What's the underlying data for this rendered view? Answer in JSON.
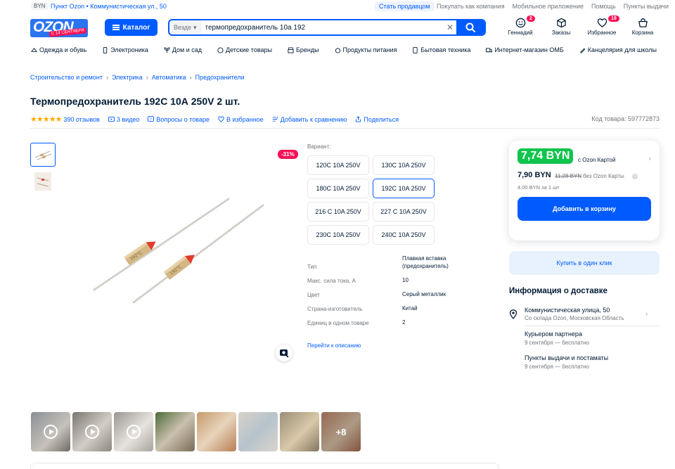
{
  "topbar": {
    "currency": "BYN",
    "pickup_point": "Пункт Ozon • Коммунистическая ул., 50",
    "sell_link": "Стать продавцом",
    "links": [
      "Покупать как компания",
      "Мобильное приложение",
      "Помощь",
      "Пункты выдачи"
    ]
  },
  "header": {
    "logo_text": "OZON",
    "logo_badge": "С 14 СЕНТЯБРЯ",
    "catalog_label": "Каталог",
    "search_scope": "Везде",
    "search_query": "термопредохранитель 10а 192",
    "user_label": "Геннадий",
    "user_badge": "2",
    "orders_label": "Заказы",
    "favorites_label": "Избранное",
    "favorites_badge": "19",
    "cart_label": "Корзина"
  },
  "categories": [
    "Одежда и обувь",
    "Электроника",
    "Дом и сад",
    "Детские товары",
    "Бренды",
    "Продукты питания",
    "Бытовая техника",
    "Интернет-магазин ОМБ",
    "Канцелярия для школы"
  ],
  "breadcrumb": [
    "Строительство и ремонт",
    "Электрика",
    "Автоматика",
    "Предохранители"
  ],
  "product": {
    "title": "Термопредохранитель 192С 10А 250V 2 шт.",
    "stars": "★★★★★",
    "reviews": "390 отзывов",
    "videos": "3 видео",
    "questions": "Вопросы о товаре",
    "favorite": "В избранное",
    "compare": "Добавить к сравнению",
    "share": "Поделиться",
    "code": "Код товара: 597772873",
    "discount": "-31%"
  },
  "variants": {
    "label": "Вариант:",
    "items": [
      "120C 10A 250V",
      "130C 10A 250V",
      "180C 10A 250V",
      "192C 10A 250V",
      "216 C 10A 250V",
      "227 C 10A 250V",
      "230C 10A 250V",
      "240C 10A 250V"
    ],
    "selected": "192C 10A 250V"
  },
  "specs": [
    {
      "key": "Тип",
      "value": "Плавкая вставка (предохранитель)"
    },
    {
      "key": "Макс. сила тока, А",
      "value": "10"
    },
    {
      "key": "Цвет",
      "value": "Серый металлик"
    },
    {
      "key": "Страна-изготовитель",
      "value": "Китай"
    },
    {
      "key": "Единиц в одном товаре",
      "value": "2"
    }
  ],
  "description_link": "Перейти к описанию",
  "price": {
    "card_price": "7,74 BYN",
    "card_label": "с Ozon Картой",
    "regular_price": "7,90 BYN",
    "old_price": "11,28 BYN",
    "without_card": "без Ozon Карты",
    "per_unit": "4,00 BYN за 1 шт",
    "add_to_cart": "Добавить в корзину",
    "one_click": "Купить в один клик"
  },
  "delivery": {
    "title": "Информация о доставке",
    "address": "Коммунистическая улица, 50",
    "address_sub": "Со склада Ozon, Московская Область",
    "options": [
      {
        "name": "Курьером партнера",
        "detail": "9 сентября — бесплатно"
      },
      {
        "name": "Пункты выдачи и постаматы",
        "detail": "9 сентября — бесплатно"
      }
    ]
  },
  "media_strip": {
    "more_label": "+8"
  },
  "colors": {
    "brand_blue": "#005bff",
    "sale_pink": "#f91155",
    "card_green": "#10c44c"
  }
}
